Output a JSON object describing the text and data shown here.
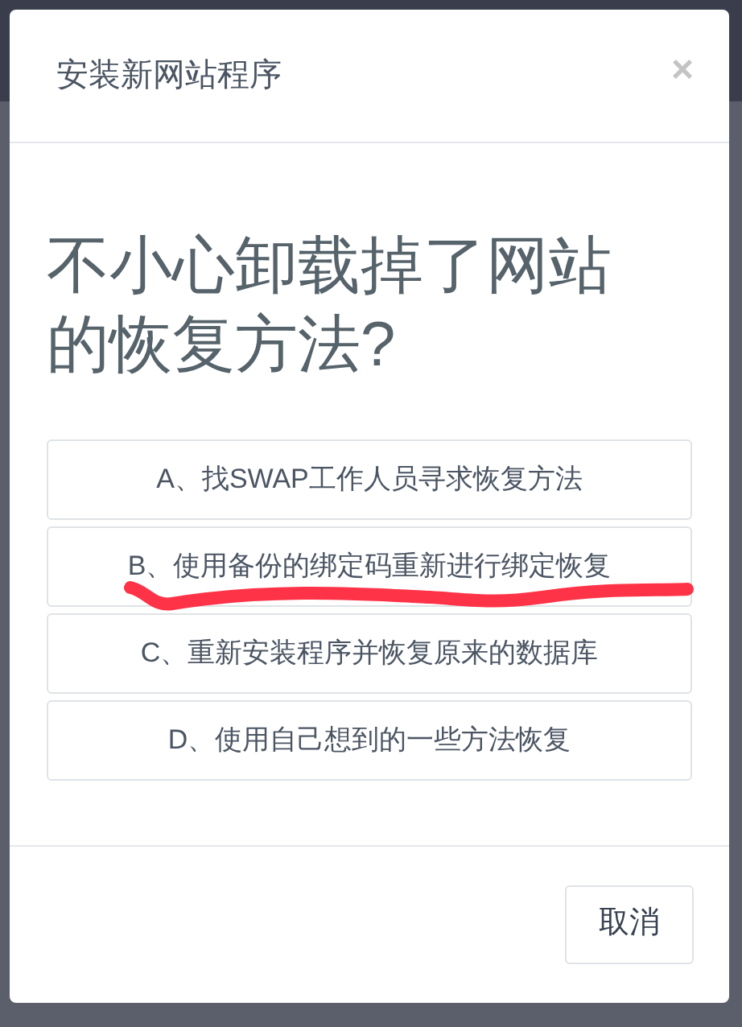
{
  "dialog": {
    "title": "安装新网站程序",
    "close": "×",
    "question": "不小心卸载掉了网站的恢复方法?",
    "options": [
      {
        "label": "A、找SWAP工作人员寻求恢复方法",
        "underlined": false
      },
      {
        "label": "B、使用备份的绑定码重新进行绑定恢复",
        "underlined": true
      },
      {
        "label": "C、重新安装程序并恢复原来的数据库",
        "underlined": false
      },
      {
        "label": "D、使用自己想到的一些方法恢复",
        "underlined": false
      }
    ],
    "cancel": "取消"
  }
}
